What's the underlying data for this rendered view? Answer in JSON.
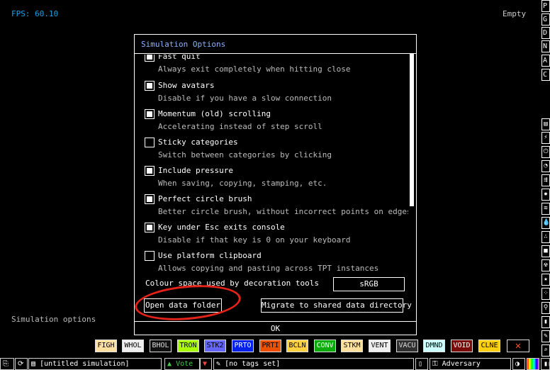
{
  "status": {
    "fps_label": "FPS: 60.10",
    "sample_label": "Empty",
    "hint": "Simulation options"
  },
  "dialog": {
    "title": "Simulation Options",
    "options": [
      {
        "label": "Fast quit",
        "desc": "Always exit completely when hitting close",
        "checked": true
      },
      {
        "label": "Show avatars",
        "desc": "Disable if you have a slow connection",
        "checked": true
      },
      {
        "label": "Momentum (old) scrolling",
        "desc": "Accelerating instead of step scroll",
        "checked": true
      },
      {
        "label": "Sticky categories",
        "desc": "Switch between categories by clicking",
        "checked": false
      },
      {
        "label": "Include pressure",
        "desc": "When saving, copying, stamping, etc.",
        "checked": true
      },
      {
        "label": "Perfect circle brush",
        "desc": "Better circle brush, without incorrect points on edges",
        "checked": true
      },
      {
        "label": "Key under Esc exits console",
        "desc": "Disable if that key is 0 on your keyboard",
        "checked": true
      },
      {
        "label": "Use platform clipboard",
        "desc": "Allows copying and pasting across TPT instances",
        "checked": false
      }
    ],
    "colour_space_label": "Colour space used by decoration tools",
    "colour_space_value": "sRGB",
    "open_data_folder": "Open data folder",
    "migrate": "Migrate to shared data directory",
    "ok": "OK"
  },
  "right_menu": [
    "P",
    "G",
    "D",
    "N",
    "A",
    "C"
  ],
  "elements": [
    {
      "name": "FIGH",
      "bg": "#ffe0a0",
      "fg": "#000"
    },
    {
      "name": "WHOL",
      "bg": "#efefef",
      "fg": "#000"
    },
    {
      "name": "BHOL",
      "bg": "#101010",
      "fg": "#ddd"
    },
    {
      "name": "TRON",
      "bg": "#a9ff00",
      "fg": "#000"
    },
    {
      "name": "STK2",
      "bg": "#6464ff",
      "fg": "#000"
    },
    {
      "name": "PRTO",
      "bg": "#0020eb",
      "fg": "#fff"
    },
    {
      "name": "PRTI",
      "bg": "#eb5000",
      "fg": "#000"
    },
    {
      "name": "BCLN",
      "bg": "#ffd040",
      "fg": "#000"
    },
    {
      "name": "CONV",
      "bg": "#0aab0a",
      "fg": "#fff"
    },
    {
      "name": "STKM",
      "bg": "#ffe0a0",
      "fg": "#000"
    },
    {
      "name": "VENT",
      "bg": "#efefef",
      "fg": "#000"
    },
    {
      "name": "VACU",
      "bg": "#303030",
      "fg": "#ddd"
    },
    {
      "name": "DMND",
      "bg": "#ccffff",
      "fg": "#000"
    },
    {
      "name": "VOID",
      "bg": "#790b0b",
      "fg": "#fff"
    },
    {
      "name": "CLNE",
      "bg": "#ffd010",
      "fg": "#000"
    }
  ],
  "bottom_bar": {
    "sim_name": "[untitled simulation]",
    "vote": "Vote",
    "tags": "[no tags set]",
    "user": "Adversary"
  }
}
